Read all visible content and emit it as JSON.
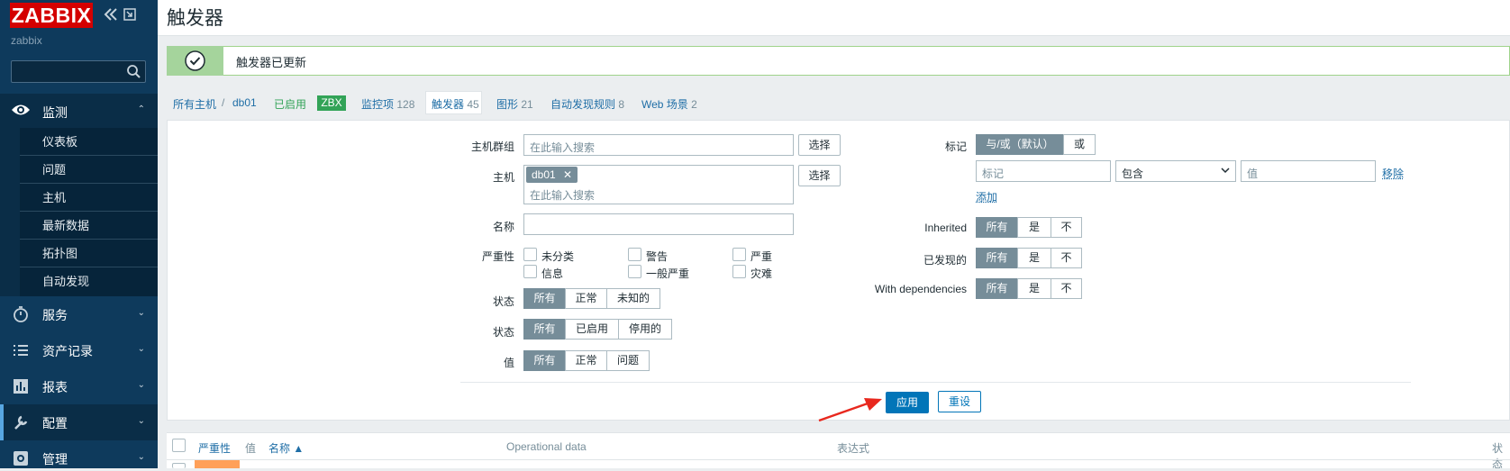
{
  "app": {
    "logo": "ZABBIX",
    "server_name": "zabbix"
  },
  "sidebar": {
    "search_placeholder": "",
    "active_section": "监测",
    "sub_items": [
      "仪表板",
      "问题",
      "主机",
      "最新数据",
      "拓扑图",
      "自动发现"
    ],
    "items": [
      {
        "label": "服务",
        "icon": "stopwatch-icon"
      },
      {
        "label": "资产记录",
        "icon": "list-icon"
      },
      {
        "label": "报表",
        "icon": "bar-chart-icon"
      },
      {
        "label": "配置",
        "icon": "wrench-icon"
      },
      {
        "label": "管理",
        "icon": "gear-icon"
      }
    ]
  },
  "page": {
    "title": "触发器"
  },
  "message": {
    "text": "触发器已更新"
  },
  "breadcrumb": {
    "all_hosts": "所有主机",
    "host": "db01",
    "enabled": "已启用",
    "badge": "ZBX",
    "items_label": "监控项",
    "items_count": "128",
    "triggers_label": "触发器",
    "triggers_count": "45",
    "graphs_label": "图形",
    "graphs_count": "21",
    "discovery_label": "自动发现规则",
    "discovery_count": "8",
    "web_label": "Web 场景",
    "web_count": "2"
  },
  "filter": {
    "host_groups_label": "主机群组",
    "host_groups_placeholder": "在此输入搜索",
    "select_label": "选择",
    "host_label": "主机",
    "host_chip": "db01",
    "host_placeholder": "在此输入搜索",
    "name_label": "名称",
    "severity_label": "严重性",
    "severities": [
      "未分类",
      "警告",
      "严重",
      "信息",
      "一般严重",
      "灾难"
    ],
    "state_label": "状态",
    "state_options": [
      "所有",
      "正常",
      "未知的"
    ],
    "status_label": "状态",
    "status_options": [
      "所有",
      "已启用",
      "停用的"
    ],
    "value_label": "值",
    "value_options": [
      "所有",
      "正常",
      "问题"
    ],
    "tags_label": "标记",
    "tag_eval_options": [
      "与/或（默认）",
      "或"
    ],
    "tag_placeholder": "标记",
    "tag_operator": "包含",
    "tag_value_placeholder": "值",
    "remove_label": "移除",
    "add_label": "添加",
    "inherited_label": "Inherited",
    "discovered_label": "已发现的",
    "deps_label": "With dependencies",
    "tri_options": [
      "所有",
      "是",
      "不"
    ],
    "apply_label": "应用",
    "reset_label": "重设"
  },
  "table": {
    "columns": [
      "严重性",
      "值",
      "名称 ▲",
      "Operational data",
      "表达式",
      "状态"
    ]
  }
}
